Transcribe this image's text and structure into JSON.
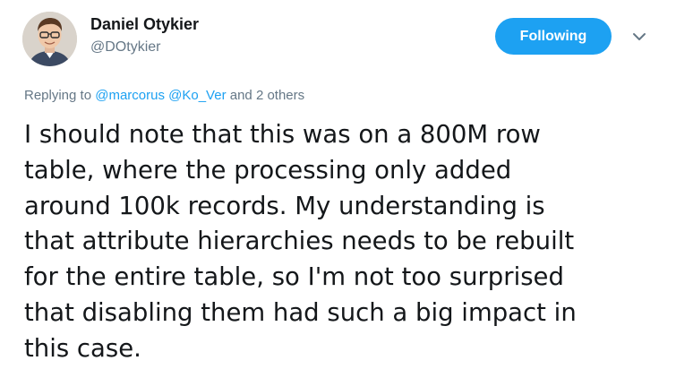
{
  "author": {
    "name": "Daniel Otykier",
    "handle": "@DOtykier",
    "avatar_icon": "user-avatar-photo"
  },
  "follow_button": {
    "label": "Following",
    "color": "#1da1f2"
  },
  "menu_icon": "chevron-down-icon",
  "reply_context": {
    "prefix": "Replying to",
    "mentions": [
      "@marcorus",
      "@Ko_Ver"
    ],
    "suffix": "and 2 others"
  },
  "tweet_text": "I should note that this was on a 800M row\ntable, where the processing only added\naround 100k records. My understanding is\nthat attribute hierarchies needs to be rebuilt\nfor the entire table, so I'm not too surprised\nthat disabling them had such a big impact in\nthis case.",
  "colors": {
    "accent": "#1da1f2",
    "secondary_text": "#657786",
    "primary_text": "#14171a"
  }
}
